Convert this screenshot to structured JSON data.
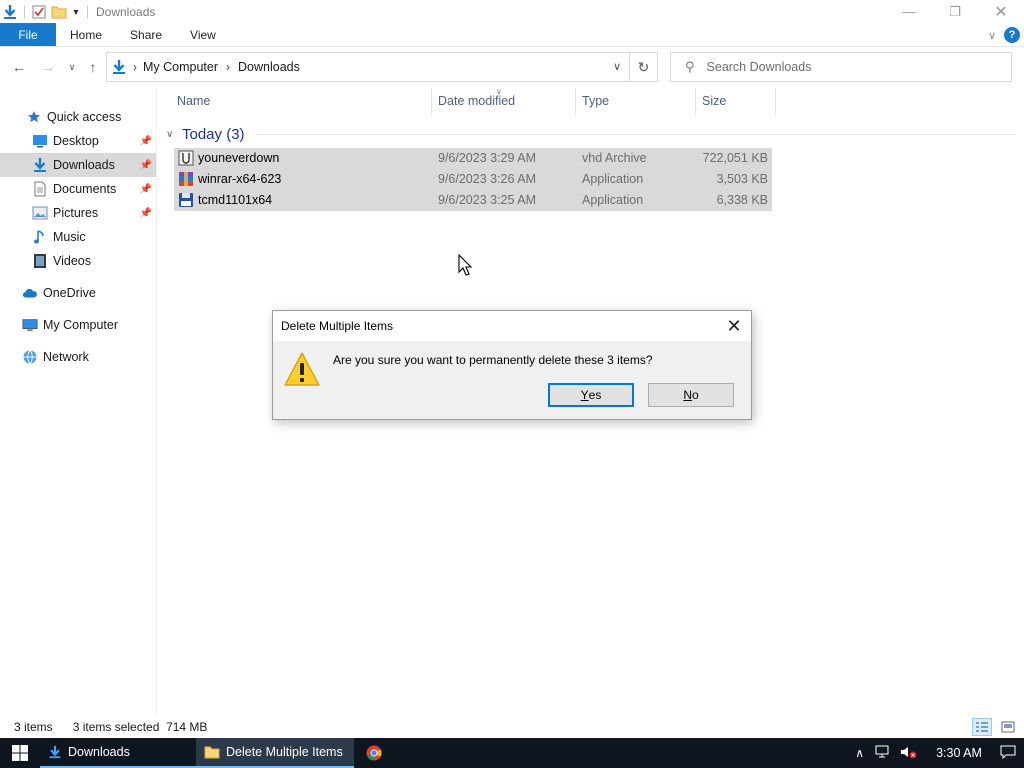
{
  "window": {
    "title": "Downloads",
    "controls": [
      "minimize-icon",
      "restore-icon",
      "close-icon"
    ]
  },
  "ribbon": {
    "tabs": [
      "File",
      "Home",
      "Share",
      "View"
    ]
  },
  "address": {
    "crumbs": [
      "My Computer",
      "Downloads"
    ],
    "search_placeholder": "Search Downloads"
  },
  "sidebar": {
    "items": [
      {
        "label": "Quick access",
        "icon": "star-icon"
      },
      {
        "label": "Desktop",
        "icon": "desktop-icon",
        "pinned": true
      },
      {
        "label": "Downloads",
        "icon": "download-icon",
        "pinned": true,
        "selected": true
      },
      {
        "label": "Documents",
        "icon": "document-icon",
        "pinned": true
      },
      {
        "label": "Pictures",
        "icon": "pictures-icon",
        "pinned": true
      },
      {
        "label": "Music",
        "icon": "music-icon"
      },
      {
        "label": "Videos",
        "icon": "videos-icon"
      },
      {
        "label": "OneDrive",
        "icon": "cloud-icon"
      },
      {
        "label": "My Computer",
        "icon": "computer-icon"
      },
      {
        "label": "Network",
        "icon": "network-icon"
      }
    ]
  },
  "columns": {
    "name": "Name",
    "date": "Date modified",
    "type": "Type",
    "size": "Size"
  },
  "group": {
    "label": "Today (3)"
  },
  "files": [
    {
      "name": "youneverdown",
      "date": "9/6/2023 3:29 AM",
      "type": "vhd Archive",
      "size": "722,051 KB",
      "icon": "archive-file-icon"
    },
    {
      "name": "winrar-x64-623",
      "date": "9/6/2023 3:26 AM",
      "type": "Application",
      "size": "3,503 KB",
      "icon": "winrar-app-icon"
    },
    {
      "name": "tcmd1101x64",
      "date": "9/6/2023 3:25 AM",
      "type": "Application",
      "size": "6,338 KB",
      "icon": "floppy-app-icon"
    }
  ],
  "dialog": {
    "title": "Delete Multiple Items",
    "message": "Are you sure you want to permanently delete these 3 items?",
    "yes_accel": "Y",
    "yes_rest": "es",
    "no_accel": "N",
    "no_rest": "o"
  },
  "status": {
    "count": "3 items",
    "selection": "3 items selected  714 MB"
  },
  "taskbar": {
    "apps": [
      "Downloads",
      "Delete Multiple Items"
    ],
    "time": "3:30 AM"
  },
  "colors": {
    "accent": "#1979ca",
    "selection": "#d9d9d9",
    "taskbar": "#10161f"
  }
}
